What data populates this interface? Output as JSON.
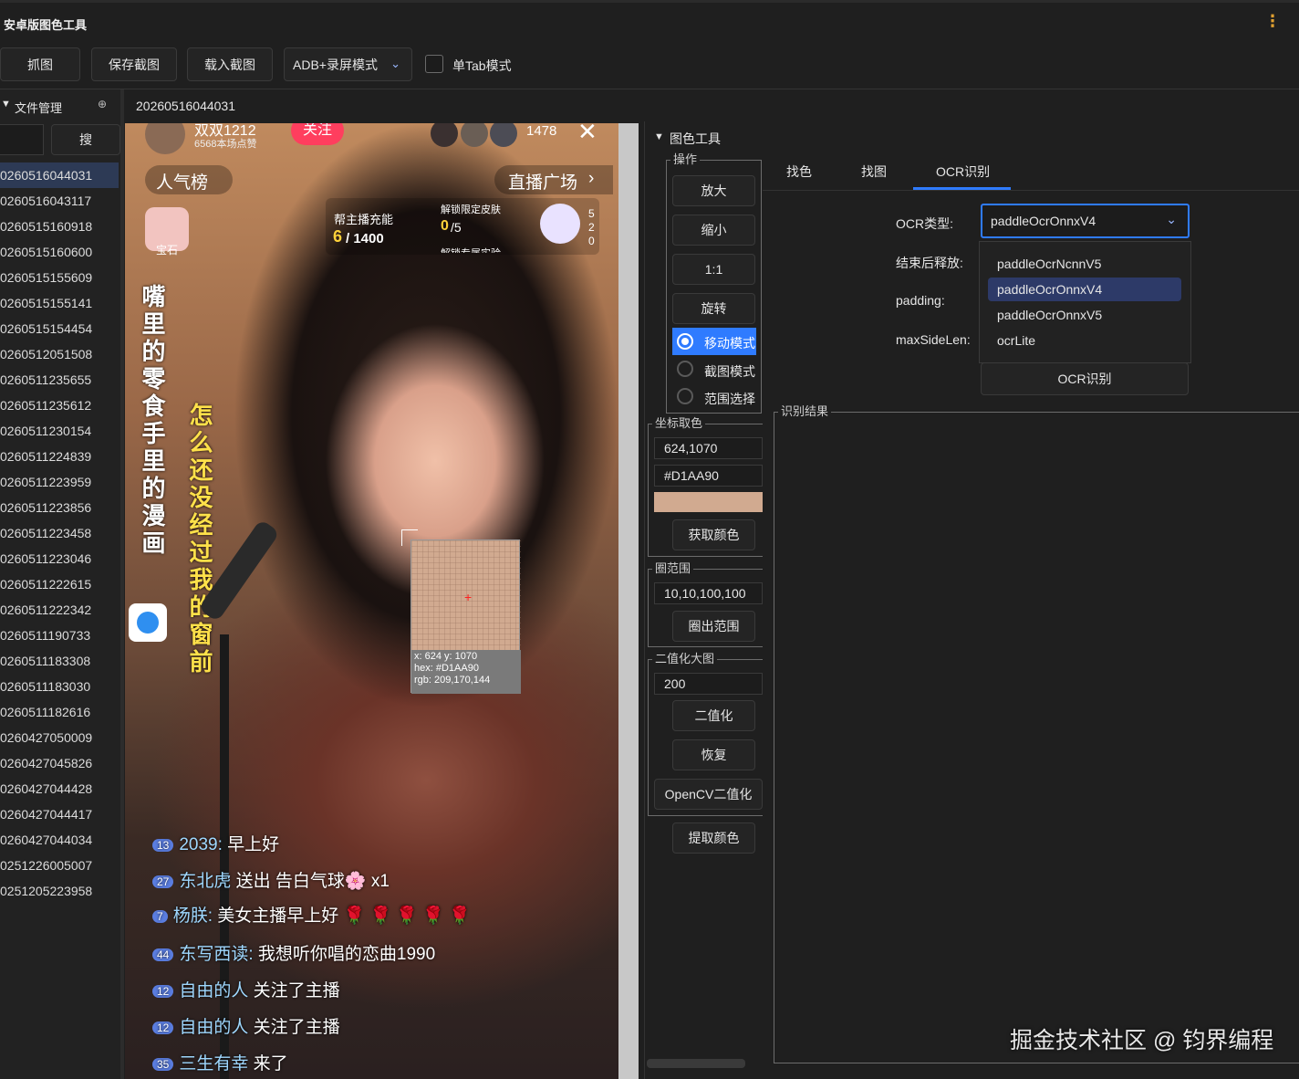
{
  "window": {
    "title": "安卓版图色工具"
  },
  "toolbar": {
    "capture": "抓图",
    "save_capture": "保存截图",
    "load_capture": "载入截图",
    "mode_select": "ADB+录屏模式",
    "single_tab": "单Tab模式"
  },
  "file_panel": {
    "title": "文件管理",
    "search_button": "搜",
    "files": [
      "0260516044031",
      "0260516043117",
      "0260515160918",
      "0260515160600",
      "0260515155609",
      "0260515155141",
      "0260515154454",
      "0260512051508",
      "0260511235655",
      "0260511235612",
      "0260511230154",
      "0260511224839",
      "0260511223959",
      "0260511223856",
      "0260511223458",
      "0260511223046",
      "0260511222615",
      "0260511222342",
      "0260511190733",
      "0260511183308",
      "0260511183030",
      "0260511182616",
      "0260427050009",
      "0260427045826",
      "0260427044428",
      "0260427044417",
      "0260427044034",
      "0251226005007",
      "0251205223958"
    ],
    "selected_index": 0
  },
  "image_tab": {
    "title": "20260516044031"
  },
  "stream": {
    "streamer_name": "双双1212",
    "likes": "6568本场点赞",
    "follow": "关注",
    "viewer_count": "1478",
    "popularity": "人气榜",
    "plaza": "直播广场",
    "gem": "宝石",
    "charge_label": "帮主播充能",
    "charge_value": "6",
    "charge_total": "/ 1400",
    "skin_label": "解锁限定皮肤",
    "skin_value": "0",
    "skin_total": "/5",
    "skin_sub": "解锁专属实验",
    "side_digits": "5\n2\n0",
    "lyrics_left": "嘴里的零食手里的漫画",
    "lyrics_right": "怎么还没经过我的窗前",
    "chat": [
      {
        "badge": "13",
        "name": "2039:",
        "text": " 早上好"
      },
      {
        "badge": "27",
        "name": "东北虎",
        "text": " 送出 告白气球🌸 x1"
      },
      {
        "badge": "7",
        "name": "杨朕:",
        "text": " 美女主播早上好 🌹 🌹 🌹 🌹 🌹"
      },
      {
        "badge": "44",
        "name": "东写西读:",
        "text": " 我想听你唱的恋曲1990"
      },
      {
        "badge": "12",
        "name": "自由的人",
        "text": " 关注了主播"
      },
      {
        "badge": "12",
        "name": "自由的人",
        "text": " 关注了主播"
      },
      {
        "badge": "35",
        "name": "三生有幸",
        "text": " 来了"
      }
    ],
    "magnifier": {
      "coord": "x: 624 y: 1070",
      "hex": "hex: #D1AA90",
      "rgb": "rgb: 209,170,144"
    }
  },
  "tools_panel": {
    "title": "图色工具",
    "ops_group": "操作",
    "zoom_in": "放大",
    "zoom_out": "缩小",
    "one_to_one": "1:1",
    "rotate": "旋转",
    "modes": [
      {
        "label": "移动模式",
        "checked": true
      },
      {
        "label": "截图模式",
        "checked": false
      },
      {
        "label": "范围选择",
        "checked": false
      }
    ],
    "coord_group": "坐标取色",
    "coord_value": "624,1070",
    "color_value": "#D1AA90",
    "swatch_color": "#D1AA90",
    "get_color": "获取颜色",
    "range_group": "圈范围",
    "range_value": "10,10,100,100",
    "draw_range": "圈出范围",
    "binarize_group": "二值化大图",
    "binarize_value": "200",
    "binarize": "二值化",
    "restore": "恢复",
    "opencv_binarize": "OpenCV二值化",
    "extract_color": "提取颜色"
  },
  "tabs": [
    {
      "label": "找色",
      "active": false
    },
    {
      "label": "找图",
      "active": false
    },
    {
      "label": "OCR识别",
      "active": true
    }
  ],
  "ocr": {
    "type_label": "OCR类型:",
    "type_value": "paddleOcrOnnxV4",
    "release_label": "结束后释放:",
    "padding_label": "padding:",
    "maxside_label": "maxSideLen:",
    "options": [
      "paddleOcrNcnnV5",
      "paddleOcrOnnxV4",
      "paddleOcrOnnxV5",
      "ocrLite"
    ],
    "highlighted_option": 1,
    "run_button": "OCR识别",
    "result_group": "识别结果"
  },
  "watermark": "掘金技术社区 @ 钧界编程",
  "colors": {
    "accent": "#2f7bff",
    "tab_underline": "#2f7bff",
    "selected_row": "#2d3a55"
  }
}
